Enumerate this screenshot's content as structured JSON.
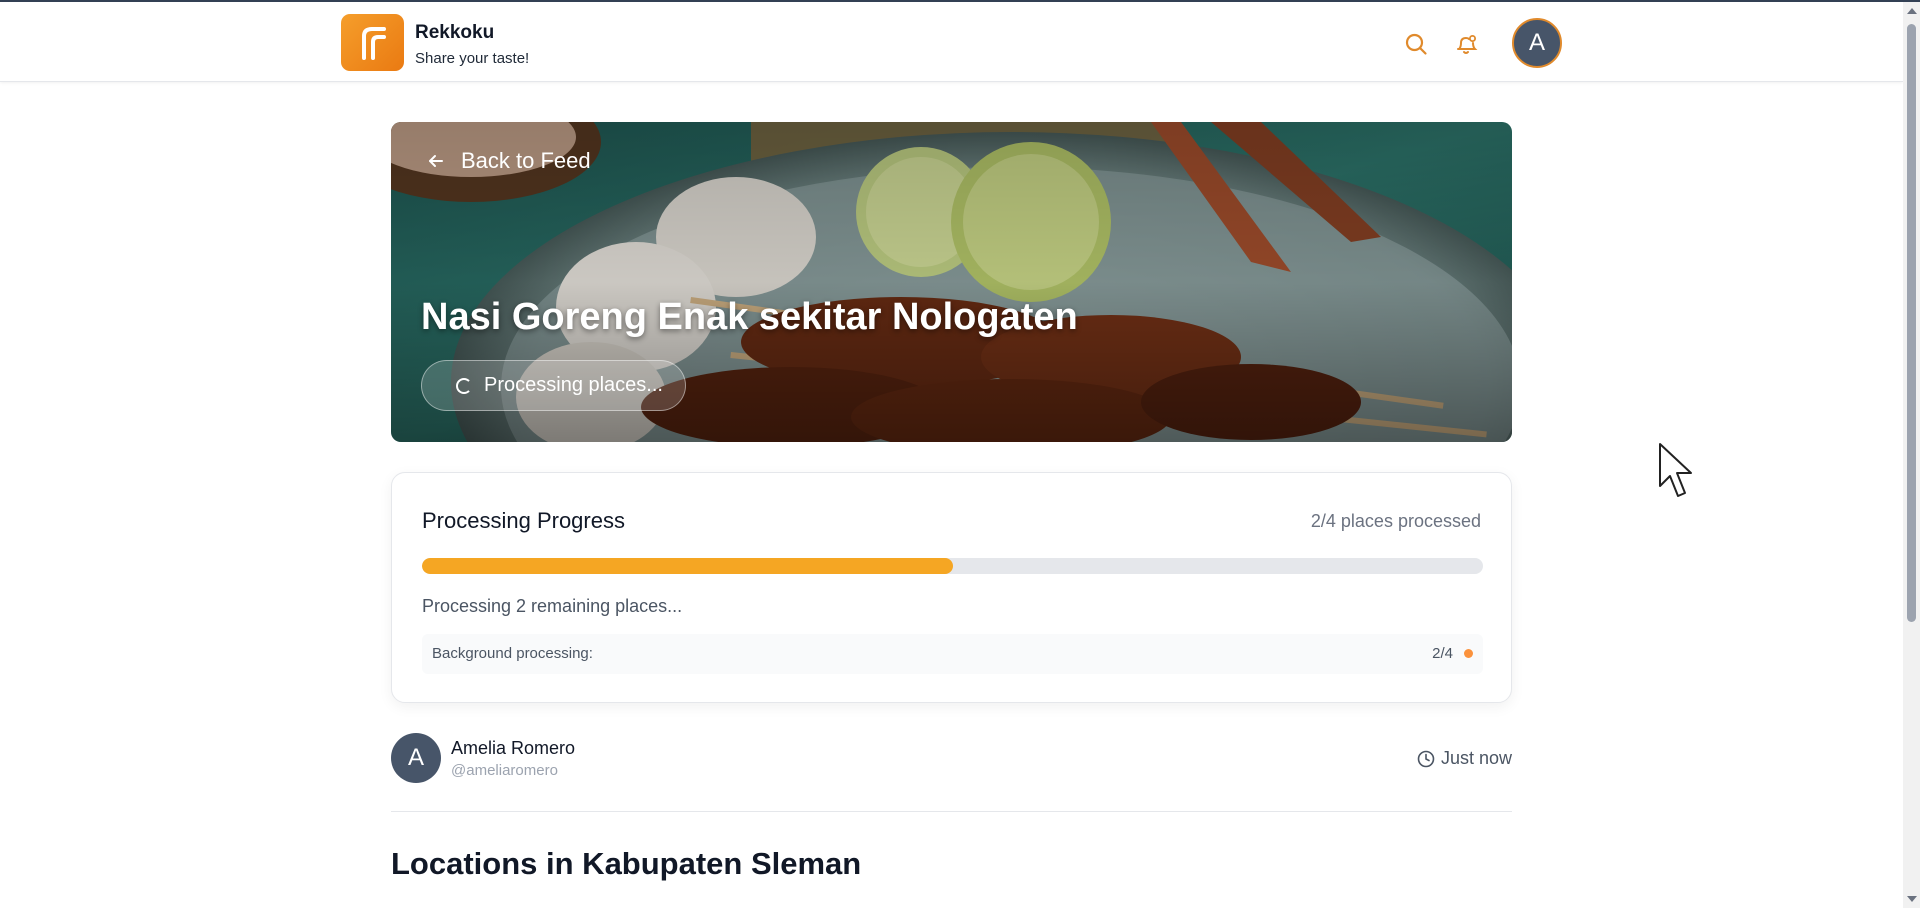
{
  "app": {
    "name": "Rekkoku",
    "tagline": "Share your taste!",
    "user_initial": "A"
  },
  "header": {
    "icons": [
      "search-icon",
      "bell-icon"
    ]
  },
  "hero": {
    "back_label": "Back to Feed",
    "title": "Nasi Goreng Enak sekitar Nologaten",
    "status_label": "Processing places..."
  },
  "progress": {
    "title": "Processing Progress",
    "count_label": "2/4 places processed",
    "processed": 2,
    "total": 4,
    "fraction": 0.5,
    "status": "Processing 2 remaining places...",
    "background_label": "Background processing:",
    "background_count": "2/4",
    "bar_color": "#f5a623",
    "dot_color": "#fb923c"
  },
  "author": {
    "initial": "A",
    "name": "Amelia Romero",
    "handle": "@ameliaromero",
    "time": "Just now"
  },
  "section": {
    "title": "Locations in Kabupaten Sleman"
  },
  "colors": {
    "accent": "#f08a24",
    "avatar": "#475569"
  }
}
